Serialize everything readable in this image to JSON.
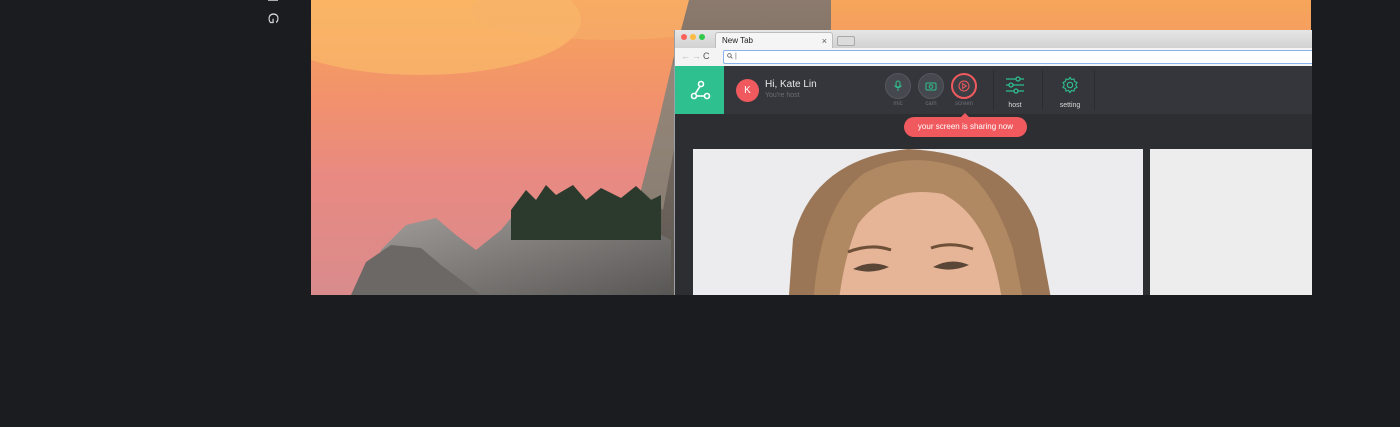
{
  "side_text": {
    "letters": [
      "N",
      "G"
    ]
  },
  "browser": {
    "tab_title": "New Tab",
    "tab_close": "×",
    "nav_back": "←",
    "nav_forward": "→",
    "nav_reload": "C",
    "address_value": "|"
  },
  "app": {
    "user_initial": "K",
    "greeting": "Hi, Kate Lin",
    "role": "You're host",
    "controls": [
      {
        "label": "mic",
        "icon": "mic-icon"
      },
      {
        "label": "cam",
        "icon": "camera-icon"
      },
      {
        "label": "screen",
        "icon": "play-icon"
      }
    ],
    "tools": [
      {
        "label": "host",
        "icon": "sliders-icon"
      },
      {
        "label": "setting",
        "icon": "gear-icon"
      }
    ],
    "toast": "your screen is sharing now",
    "colors": {
      "brand": "#2fc08f",
      "accent": "#f05a5e",
      "header": "#34363b"
    }
  }
}
